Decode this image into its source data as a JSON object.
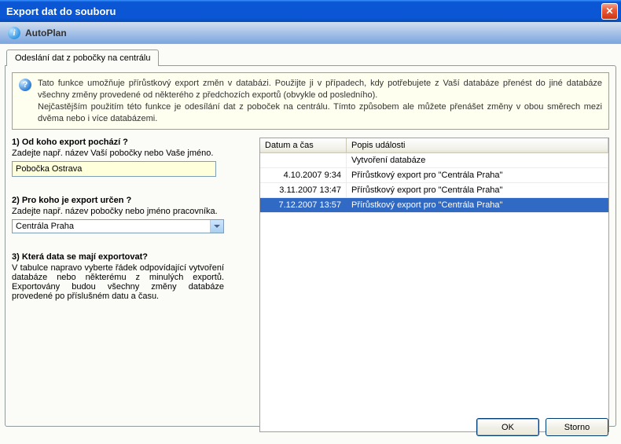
{
  "titlebar": {
    "title": "Export dat do souboru"
  },
  "subbar": {
    "app_name": "AutoPlan"
  },
  "tab": {
    "label": "Odeslání dat z pobočky na centrálu"
  },
  "help": {
    "text": "Tato funkce umožňuje přírůstkový export změn v databázi. Použijte ji v případech, kdy potřebujete z Vaší databáze přenést do jiné databáze všechny změny provedené od některého z předchozích exportů (obvykle od posledního).\nNejčastějším použitím této funkce je odesílání dat z poboček na centrálu. Tímto způsobem ale můžete přenášet změny v obou směrech mezi dvěma nebo i více databázemi."
  },
  "section1": {
    "title": "1) Od koho export pochází ?",
    "desc": "Zadejte např. název Vaší pobočky nebo Vaše jméno.",
    "value": "Pobočka Ostrava"
  },
  "section2": {
    "title": "2) Pro koho je export určen ?",
    "desc": "Zadejte např. název pobočky nebo jméno pracovníka.",
    "value": "Centrála Praha"
  },
  "section3": {
    "title": "3) Která data se mají exportovat?",
    "desc": "V tabulce napravo vyberte řádek odpovídající vytvoření databáze nebo některému z minulých exportů. Exportovány budou všechny změny databáze provedené po příslušném datu a času."
  },
  "table": {
    "headers": {
      "date": "Datum a čas",
      "desc": "Popis události"
    },
    "rows": [
      {
        "date": "",
        "desc": "Vytvoření databáze",
        "selected": false
      },
      {
        "date": "4.10.2007   9:34",
        "desc": "Přírůstkový export pro \"Centrála Praha\"",
        "selected": false
      },
      {
        "date": "3.11.2007 13:47",
        "desc": "Přírůstkový export pro \"Centrála Praha\"",
        "selected": false
      },
      {
        "date": "7.12.2007 13:57",
        "desc": "Přírůstkový export pro \"Centrála Praha\"",
        "selected": true
      }
    ]
  },
  "buttons": {
    "ok": "OK",
    "cancel": "Storno"
  }
}
